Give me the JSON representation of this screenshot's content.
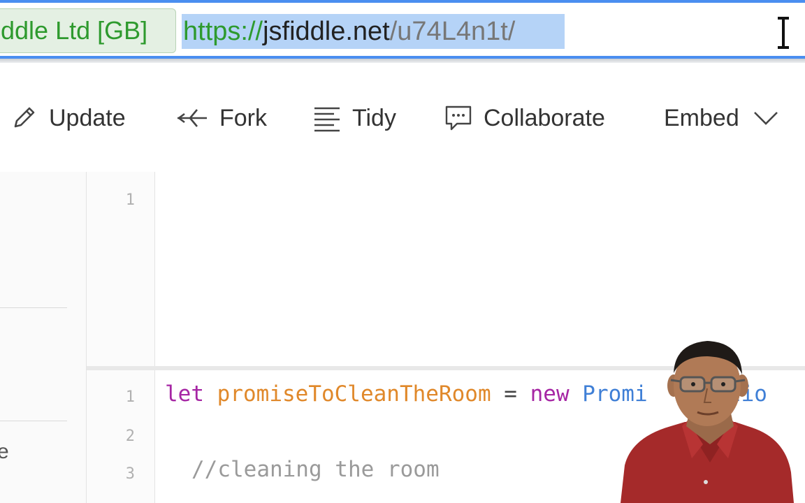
{
  "browser": {
    "ev_badge": "ddle Ltd [GB]",
    "url": {
      "scheme": "https://",
      "host": "jsfiddle.net",
      "path": "/u74L4n1t/"
    }
  },
  "toolbar": {
    "update_label": "Update",
    "fork_label": "Fork",
    "tidy_label": "Tidy",
    "collaborate_label": "Collaborate",
    "embed_label": "Embed"
  },
  "sidebar": {
    "partial_text": "e"
  },
  "html_editor": {
    "line_numbers": [
      "1"
    ]
  },
  "js_editor": {
    "line_numbers": [
      "1",
      "2",
      "3"
    ],
    "line1": {
      "kw_let": "let",
      "var_name": "promiseToCleanTheRoom",
      "op_eq": "=",
      "kw_new": "new",
      "cls_promise": "Promi",
      "cls_tail": "nctio"
    },
    "line3_comment": "//cleaning the room"
  },
  "colors": {
    "accent_blue": "#4a8ef0",
    "secure_green": "#2e9a2e",
    "selection": "#b5d3f7"
  }
}
